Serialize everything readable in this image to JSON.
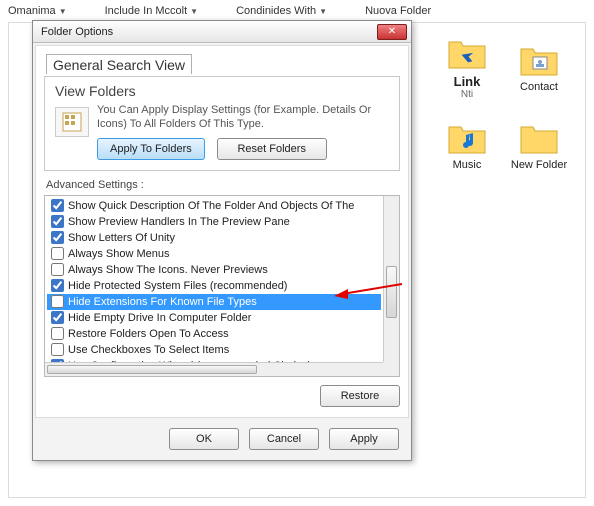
{
  "toolbar": {
    "i0": "Omanima",
    "i1": "Include In Mccolt",
    "i2": "Condinides With",
    "i3": "Nuova Folder"
  },
  "icons": {
    "link": "Link",
    "linksub": "Nti",
    "contact": "Contact",
    "music": "Music",
    "newfolder": "New Folder"
  },
  "dialog": {
    "title": "Folder Options",
    "tabs": "General Search View",
    "panel_title": "View Folders",
    "panel_text": "You Can Apply Display Settings (for Example. Details Or Icons) To All Folders Of This Type.",
    "apply_to": "Apply To Folders",
    "reset": "Reset Folders",
    "adv": "Advanced Settings :",
    "restore": "Restore",
    "ok": "OK",
    "cancel": "Cancel",
    "apply": "Apply"
  },
  "settings": [
    {
      "c": true,
      "t": "Show Quick Description Of The Folder And Objects Of The"
    },
    {
      "c": true,
      "t": "Show Preview Handlers In The Preview Pane"
    },
    {
      "c": true,
      "t": "Show Letters Of Unity"
    },
    {
      "c": false,
      "t": "Always Show Menus"
    },
    {
      "c": false,
      "t": "Always Show The Icons. Never Previews"
    },
    {
      "c": true,
      "t": "Hide Protected System Files (recommended)"
    },
    {
      "c": false,
      "t": "Hide Extensions For Known File Types",
      "sel": true
    },
    {
      "c": true,
      "t": "Hide Empty Drive In Computer Folder"
    },
    {
      "c": false,
      "t": "Restore Folders Open To Access"
    },
    {
      "c": false,
      "t": "Use Checkboxes To Select Items"
    },
    {
      "c": true,
      "t": "Use Configuration Wizard (recommended Choice)"
    }
  ]
}
